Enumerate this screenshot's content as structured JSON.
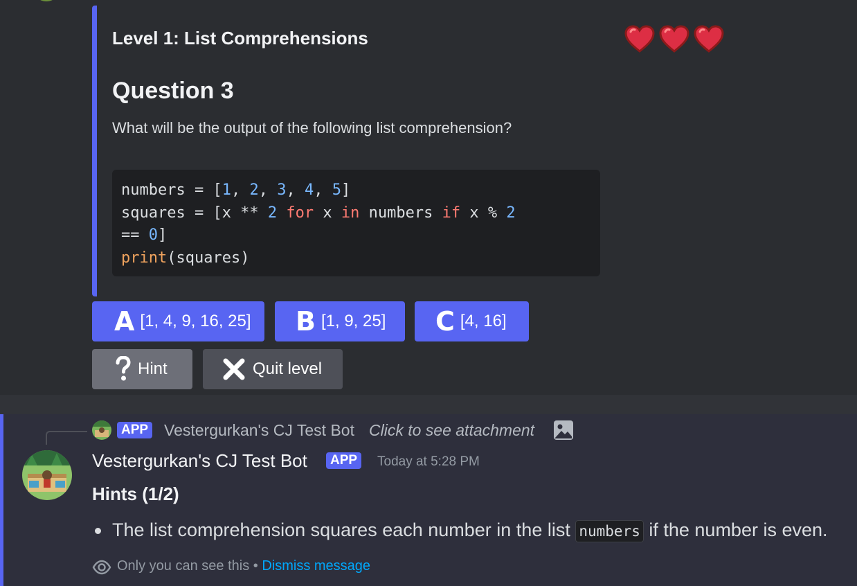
{
  "embed": {
    "title": "Level 1: List Comprehensions",
    "lives_icon": "heart-icon",
    "lives": 3,
    "question": "Question 3",
    "prompt": "What will be the output of the following list comprehension?",
    "code_lines": [
      "numbers = [1, 2, 3, 4, 5]",
      "squares = [x ** 2 for x in numbers if x % 2",
      "== 0]",
      "print(squares)"
    ],
    "accent_color": "#5865f2"
  },
  "answers": [
    {
      "letter": "A",
      "text": "[1, 4, 9, 16, 25]"
    },
    {
      "letter": "B",
      "text": "[1, 9, 25]"
    },
    {
      "letter": "C",
      "text": "[4, 16]"
    }
  ],
  "actions": {
    "hint_label": "Hint",
    "hint_icon": "question-mark-icon",
    "quit_label": "Quit level",
    "quit_icon": "x-icon"
  },
  "reply": {
    "badge": "APP",
    "name": "Vestergurkan's CJ Test Bot",
    "link_text": "Click to see attachment",
    "icon": "image-icon"
  },
  "message": {
    "author": "Vestergurkan's CJ Test Bot",
    "badge": "APP",
    "timestamp": "Today at 5:28 PM",
    "title": "Hints (1/2)",
    "hint_before": "The list comprehension squares each number in the list ",
    "hint_code": "numbers",
    "hint_after": " if the number is even.",
    "ephemeral_text": "Only you can see this",
    "separator": " • ",
    "dismiss_label": "Dismiss message"
  }
}
